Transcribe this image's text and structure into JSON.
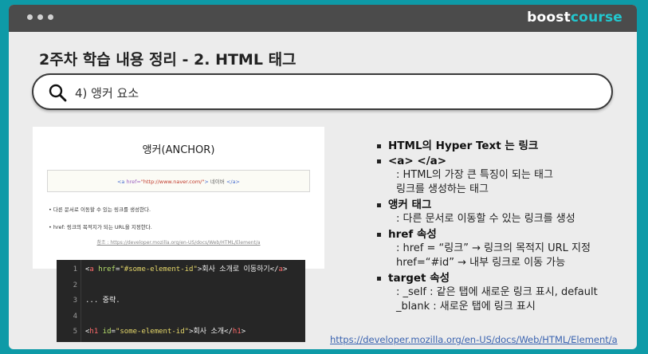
{
  "header": {
    "brand_part1": "boost",
    "brand_part2": "course"
  },
  "page": {
    "title": "2주차 학습 내용 정리 - 2. HTML 태그"
  },
  "search": {
    "query": "4) 앵커 요소"
  },
  "left_panel": {
    "title": "앵커(ANCHOR)",
    "code_example": {
      "tag_open": "<a",
      "attr": "href=",
      "value": "\"http://www.naver.com/\"",
      "close": ">",
      "text": "네이버",
      "tag_end": "</a>"
    },
    "bullets": [
      "다른 문서로 이동할 수 있는 링크를 생성한다.",
      "href: 링크의 목적지가 되는 URL을 지정한다."
    ],
    "reference": "참조 : https://developer.mozilla.org/en-US/docs/Web/HTML/Element/a"
  },
  "code_block": {
    "lines": [
      {
        "num": "1",
        "parts": [
          [
            "tk-txt",
            "<"
          ],
          [
            "tk-tag",
            "a"
          ],
          [
            "tk-attr",
            " href"
          ],
          [
            "tk-txt",
            "="
          ],
          [
            "tk-str",
            "\"#some-element-id\""
          ],
          [
            "tk-txt",
            ">회사 소개로 이동하기</"
          ],
          [
            "tk-tag",
            "a"
          ],
          [
            "tk-txt",
            ">"
          ]
        ]
      },
      {
        "num": "2",
        "parts": []
      },
      {
        "num": "3",
        "parts": [
          [
            "tk-txt",
            "... 중략."
          ]
        ]
      },
      {
        "num": "4",
        "parts": []
      },
      {
        "num": "5",
        "parts": [
          [
            "tk-txt",
            "<"
          ],
          [
            "tk-tag",
            "h1"
          ],
          [
            "tk-attr",
            " id"
          ],
          [
            "tk-txt",
            "="
          ],
          [
            "tk-str",
            "\"some-element-id\""
          ],
          [
            "tk-txt",
            ">회사 소개</"
          ],
          [
            "tk-tag",
            "h1"
          ],
          [
            "tk-txt",
            ">"
          ]
        ]
      }
    ]
  },
  "bullets": [
    {
      "head": "HTML의 Hyper Text 는 링크",
      "subs": []
    },
    {
      "head": "<a> </a>",
      "subs": [
        ": HTML의 가장 큰 특징이 되는 태그",
        "링크를 생성하는 태그"
      ]
    },
    {
      "head": "앵커 태그",
      "subs": [
        ": 다른 문서로 이동할 수 있는 링크를 생성"
      ]
    },
    {
      "head": "href 속성",
      "subs": [
        ": href = “링크” → 링크의 목적지 URL 지정",
        "href=“#id” → 내부 링크로 이동 가능"
      ]
    },
    {
      "head": "target 속성",
      "subs": [
        ": _self : 같은 탭에 새로운 링크 표시, default",
        "_blank : 새로운 탭에 링크 표시"
      ]
    }
  ],
  "footer": {
    "link": "https://developer.mozilla.org/en-US/docs/Web/HTML/Element/a"
  },
  "colors": {
    "background": "#0e9aa7",
    "brand_accent": "#22c7cf",
    "topbar": "#4b4b4b",
    "link": "#3a63b0"
  },
  "icons": [
    "window-dot-icon",
    "search-icon",
    "bullet-square-icon"
  ]
}
